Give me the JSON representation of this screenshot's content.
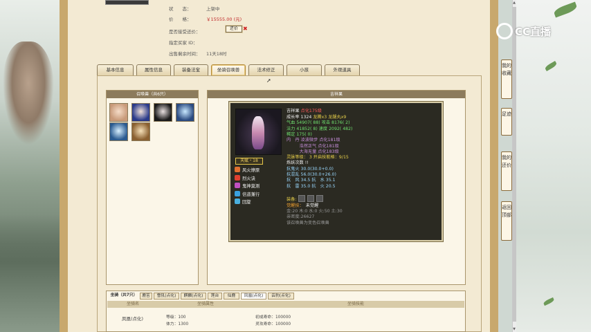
{
  "info": {
    "rows": [
      {
        "label": "状　　态：",
        "value": "上架中"
      },
      {
        "label": "价　　格：",
        "value": "￥15555.00 (元)"
      },
      {
        "label": "是否接受还价：",
        "value": ""
      },
      {
        "label": "指定买家 ID：",
        "value": ""
      },
      {
        "label": "出售剩余时间：",
        "value": "11天18时"
      }
    ],
    "offer_button": "还价",
    "close_symbol": "✖"
  },
  "tabs": [
    "基本信息",
    "属性信息",
    "装备法宝",
    "坐骑召唤兽",
    "法术修正",
    "小孩",
    "外观道具"
  ],
  "pets_panel": {
    "title": "召唤兽（共6只）",
    "pets": [
      {
        "name": "pet-1",
        "color": "#e8c8b0"
      },
      {
        "name": "pet-2",
        "color": "#3a4a8a"
      },
      {
        "name": "pet-3",
        "color": "#2a2a2a"
      },
      {
        "name": "pet-4",
        "color": "#5a8ab8"
      },
      {
        "name": "pet-5",
        "color": "#4a7ab0"
      },
      {
        "name": "pet-6",
        "color": "#b89060"
      }
    ]
  },
  "detail": {
    "title": "吉祥果",
    "name": "吉祥果",
    "badge": "点化175级",
    "lines": [
      {
        "parts": [
          {
            "t": "成长率 1324  ",
            "c": "w"
          },
          {
            "t": "龙腾x3 龙腿丸x9",
            "c": "y"
          }
        ]
      },
      {
        "parts": [
          {
            "t": "气血 54907( 88) 攻击 8176( 2)",
            "c": "g"
          }
        ]
      },
      {
        "parts": [
          {
            "t": "法力 41852( 8) 速度 2092( 482)",
            "c": "g"
          }
        ]
      },
      {
        "parts": [
          {
            "t": "稀定 175( 0)",
            "c": "g"
          }
        ]
      },
      {
        "parts": [
          {
            "t": "内　丹 凌波微步 点化181级",
            "c": "p"
          }
        ]
      },
      {
        "parts": [
          {
            "t": "　　　浩然正气 点化181级",
            "c": "p"
          }
        ]
      },
      {
        "parts": [
          {
            "t": "　　　大海无量 点化183级",
            "c": "p"
          }
        ]
      },
      {
        "parts": [
          {
            "t": "灵脉等级：  3 开启技能格：9/15",
            "c": "y"
          }
        ]
      },
      {
        "parts": [
          {
            "t": "炼妖次数 !!",
            "c": "w"
          }
        ]
      },
      {
        "parts": [
          {
            "t": "抗鬼火 30.0(30.0+0.0)",
            "c": "c"
          }
        ]
      },
      {
        "parts": [
          {
            "t": "抗混乱 56.0(30.0+26.0)",
            "c": "c"
          }
        ]
      },
      {
        "parts": [
          {
            "t": "抗　风 34.5 抗　水 35.1",
            "c": "c"
          }
        ]
      },
      {
        "parts": [
          {
            "t": "抗　雷 35.0 抗　火 20.5",
            "c": "c"
          }
        ]
      }
    ],
    "equip_label": "装备:",
    "awaken": {
      "label": "觉醒技：",
      "value": "未觉醒"
    },
    "elements": "金:20 木:0 水:0 火:50 土:30",
    "intimacy": "亲密度:26627",
    "note": "该召唤兽为变色召唤兽",
    "tianfu": "天赋・18",
    "skills": [
      {
        "label": "风火燎原",
        "color": "#e07030"
      },
      {
        "label": "烈火诀",
        "color": "#e04030"
      },
      {
        "label": "鬼神莫测",
        "color": "#c050c0"
      },
      {
        "label": "倍道兼行",
        "color": "#3aa0e0"
      },
      {
        "label": "回旋",
        "color": "#4ab0e0"
      }
    ]
  },
  "bottom": {
    "tabs": [
      "坐骑（共7只）",
      "鹿苦",
      "雪犼(点化)",
      "麒麟(点化)",
      "莲台",
      "仙鹿",
      "凤凰(点化)",
      "云豹(点化)"
    ],
    "headers": [
      "坐骑名",
      "坐骑属性",
      "坐骑技能"
    ],
    "row": {
      "name": "凤凰(点化)",
      "attrs": [
        "等级：100",
        "体力：1300"
      ],
      "extra": [
        "初成寿命：100000",
        "灵攻寿命：100000"
      ]
    }
  },
  "side_nav": [
    {
      "label": "我的收藏"
    },
    {
      "label": "足迹"
    },
    {
      "label": "我的还价"
    },
    {
      "label": "返回顶部"
    }
  ],
  "logo": {
    "text": "CC直播"
  },
  "scroll": {
    "up": "▲",
    "down": "▼"
  }
}
